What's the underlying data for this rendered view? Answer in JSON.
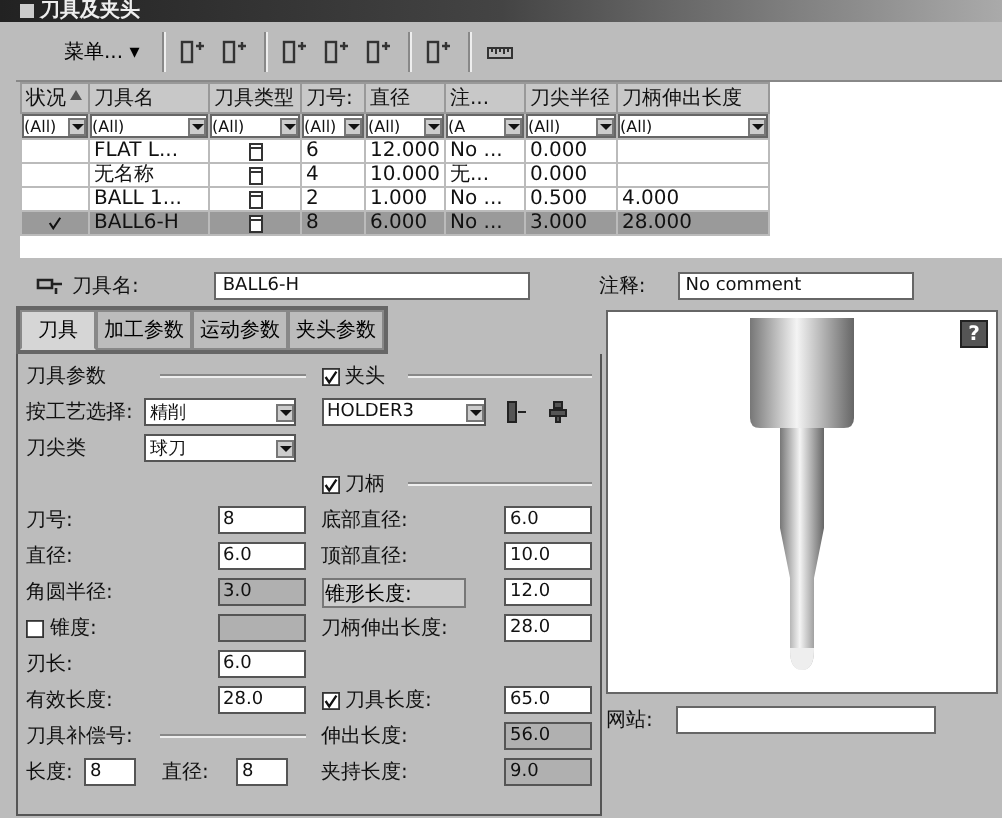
{
  "window": {
    "title": "刀具及夹头"
  },
  "toolbar": {
    "menu": "菜单...",
    "menu_caret": "▾"
  },
  "table": {
    "columns": [
      {
        "label": "状况",
        "sorted": true,
        "filter": "(All)"
      },
      {
        "label": "刀具名",
        "sorted": false,
        "filter": "(All)"
      },
      {
        "label": "刀具类型",
        "sorted": false,
        "filter": "(All)"
      },
      {
        "label": "刀号:",
        "sorted": false,
        "filter": "(All)"
      },
      {
        "label": "直径",
        "sorted": false,
        "filter": "(All)"
      },
      {
        "label": "注...",
        "sorted": false,
        "filter": "(A"
      },
      {
        "label": "刀尖半径",
        "sorted": false,
        "filter": "(All)"
      },
      {
        "label": "刀柄伸出长度",
        "sorted": false,
        "filter": "(All)"
      }
    ],
    "rows": [
      {
        "selected": false,
        "checked": false,
        "cells": [
          "",
          "FLAT L...",
          "",
          "6",
          "12.000",
          "No ...",
          "0.000",
          ""
        ]
      },
      {
        "selected": false,
        "checked": false,
        "cells": [
          "",
          "无名称",
          "",
          "4",
          "10.000",
          "无...",
          "0.000",
          ""
        ]
      },
      {
        "selected": false,
        "checked": false,
        "cells": [
          "",
          "BALL 1...",
          "",
          "2",
          "1.000",
          "No ...",
          "0.500",
          "4.000"
        ]
      },
      {
        "selected": true,
        "checked": true,
        "cells": [
          "",
          "BALL6-H",
          "",
          "8",
          "6.000",
          "No ...",
          "3.000",
          "28.000"
        ]
      }
    ]
  },
  "tool_name": {
    "label": "刀具名:",
    "value": "BALL6-H"
  },
  "comment": {
    "label": "注释:",
    "value": "No comment"
  },
  "tabs": [
    {
      "label": "刀具",
      "selected": true
    },
    {
      "label": "加工参数",
      "selected": false
    },
    {
      "label": "运动参数",
      "selected": false
    },
    {
      "label": "夹头参数",
      "selected": false
    }
  ],
  "left_fields": [
    {
      "kind": "section",
      "label": "刀具参数"
    },
    {
      "kind": "select",
      "label": "按工艺选择:",
      "value": "精削"
    },
    {
      "kind": "select",
      "label": "刀尖类",
      "value": "球刀"
    },
    {
      "kind": "blank"
    },
    {
      "kind": "input",
      "label": "刀号:",
      "value": "8",
      "disabled": false
    },
    {
      "kind": "input",
      "label": "直径:",
      "value": "6.0",
      "disabled": false
    },
    {
      "kind": "input",
      "label": "角圆半径:",
      "value": "3.0",
      "disabled": true
    },
    {
      "kind": "check-input",
      "label": "锥度:",
      "checked": false,
      "disabled": true
    },
    {
      "kind": "input",
      "label": "刃长:",
      "value": "6.0",
      "disabled": false
    },
    {
      "kind": "input",
      "label": "有效长度:",
      "value": "28.0",
      "disabled": false
    },
    {
      "kind": "section",
      "label": "刀具补偿号:"
    },
    {
      "kind": "pair",
      "label": "长度:",
      "value": "8",
      "label2": "直径:",
      "value2": "8"
    }
  ],
  "right_fields": [
    {
      "kind": "check-section",
      "label": "夹头",
      "checked": true
    },
    {
      "kind": "holder",
      "value": "HOLDER3"
    },
    {
      "kind": "blank"
    },
    {
      "kind": "check-section",
      "label": "刀柄",
      "checked": true
    },
    {
      "kind": "input",
      "label": "底部直径:",
      "value": "6.0",
      "disabled": false
    },
    {
      "kind": "input",
      "label": "顶部直径:",
      "value": "10.0",
      "disabled": false
    },
    {
      "kind": "button-input",
      "label": "锥形长度:",
      "value": "12.0",
      "disabled": false
    },
    {
      "kind": "input",
      "label": "刀柄伸出长度:",
      "value": "28.0",
      "disabled": false
    },
    {
      "kind": "blank"
    },
    {
      "kind": "check-input",
      "label": "刀具长度:",
      "checked": true,
      "value": "65.0",
      "disabled": false
    },
    {
      "kind": "input",
      "label": "伸出长度:",
      "value": "56.0",
      "disabled": true
    },
    {
      "kind": "input",
      "label": "夹持长度:",
      "value": "9.0",
      "disabled": true
    }
  ],
  "preview": {
    "help": "?",
    "website_label": "网站:"
  }
}
